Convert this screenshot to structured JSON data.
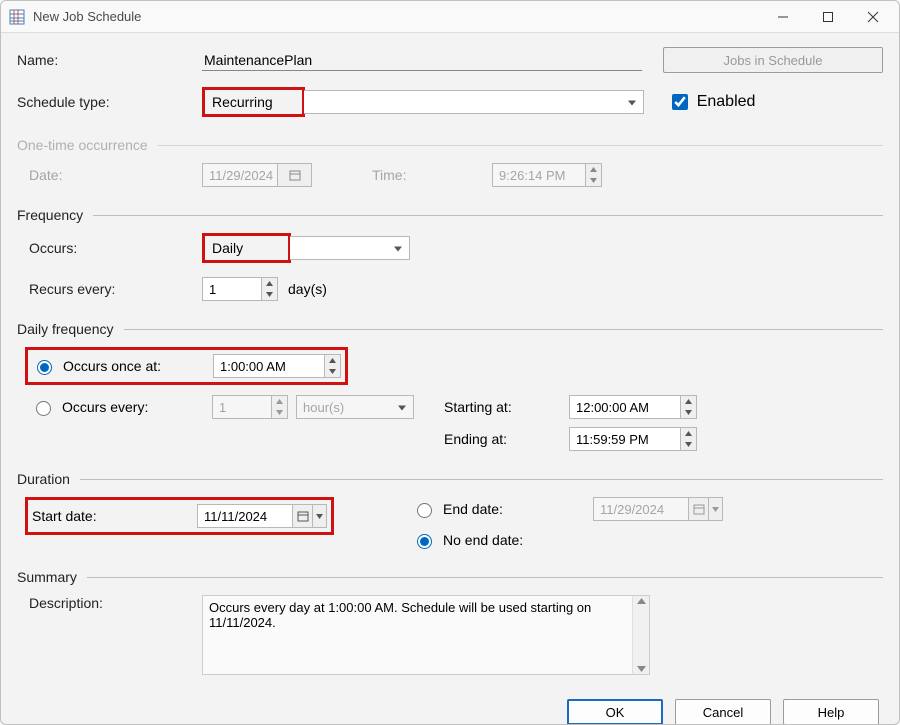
{
  "window": {
    "title": "New Job Schedule"
  },
  "labels": {
    "name": "Name:",
    "schedule_type": "Schedule type:",
    "jobs_in_schedule": "Jobs in Schedule",
    "enabled": "Enabled",
    "one_time": "One-time occurrence",
    "date": "Date:",
    "time": "Time:",
    "frequency": "Frequency",
    "occurs": "Occurs:",
    "recurs_every": "Recurs every:",
    "days": "day(s)",
    "daily_frequency": "Daily frequency",
    "occurs_once_at": "Occurs once at:",
    "occurs_every": "Occurs every:",
    "hours": "hour(s)",
    "starting_at": "Starting at:",
    "ending_at": "Ending at:",
    "duration": "Duration",
    "start_date": "Start date:",
    "end_date": "End date:",
    "no_end_date": "No end date:",
    "summary": "Summary",
    "description": "Description:",
    "ok": "OK",
    "cancel": "Cancel",
    "help": "Help"
  },
  "values": {
    "name": "MaintenancePlan",
    "schedule_type": "Recurring",
    "enabled_checked": "true",
    "one_time_date": "11/29/2024",
    "one_time_time": "9:26:14 PM",
    "occurs": "Daily",
    "recurs_every": "1",
    "occurs_once_time": "1:00:00 AM",
    "occurs_every_n": "1",
    "starting_at": "12:00:00 AM",
    "ending_at": "11:59:59 PM",
    "start_date": "11/11/2024",
    "end_date": "11/29/2024",
    "description": "Occurs every day at 1:00:00 AM. Schedule will be used starting on 11/11/2024."
  }
}
